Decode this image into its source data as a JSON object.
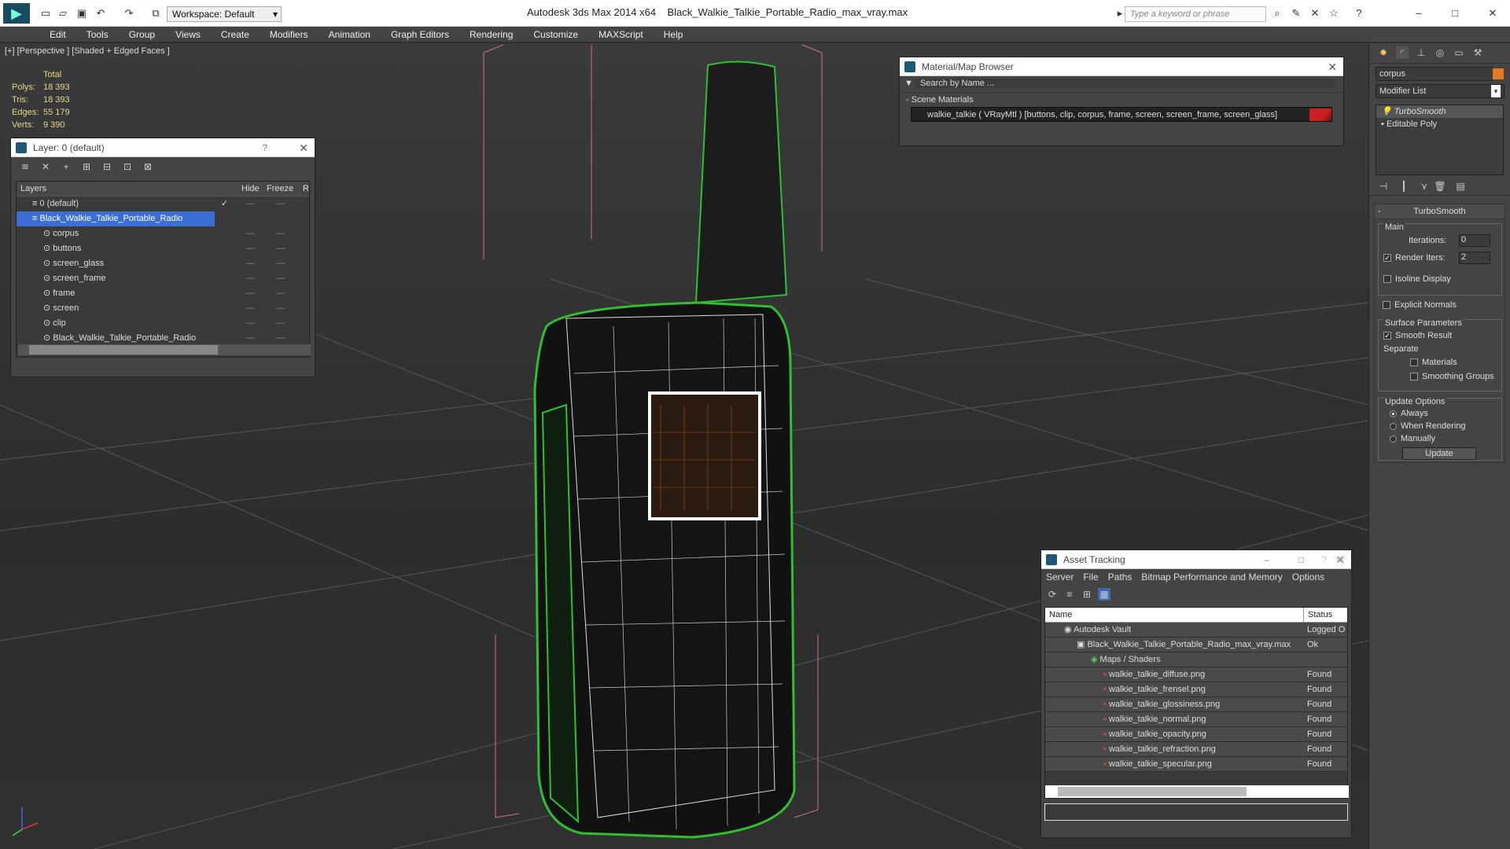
{
  "title": {
    "app": "Autodesk 3ds Max  2014 x64",
    "file": "Black_Walkie_Talkie_Portable_Radio_max_vray.max",
    "workspace": "Workspace: Default",
    "search_placeholder": "Type a keyword or phrase"
  },
  "menu": [
    "Edit",
    "Tools",
    "Group",
    "Views",
    "Create",
    "Modifiers",
    "Animation",
    "Graph Editors",
    "Rendering",
    "Customize",
    "MAXScript",
    "Help"
  ],
  "viewport": {
    "label": "[+] [Perspective ] [Shaded + Edged Faces ]",
    "stats": {
      "header": "Total",
      "rows": [
        {
          "k": "Polys:",
          "v": "18 393"
        },
        {
          "k": "Tris:",
          "v": "18 393"
        },
        {
          "k": "Edges:",
          "v": "55 179"
        },
        {
          "k": "Verts:",
          "v": "9 390"
        }
      ]
    }
  },
  "layer_panel": {
    "title": "Layer: 0 (default)",
    "cols": {
      "layers": "Layers",
      "hide": "Hide",
      "freeze": "Freeze",
      "r": "R"
    },
    "rows": [
      "0 (default)",
      "Black_Walkie_Talkie_Portable_Radio",
      "corpus",
      "buttons",
      "screen_glass",
      "screen_frame",
      "frame",
      "screen",
      "clip",
      "Black_Walkie_Talkie_Portable_Radio"
    ]
  },
  "material_browser": {
    "title": "Material/Map Browser",
    "search": "Search by Name ...",
    "section": "Scene Materials",
    "item": "walkie_talkie  ( VRayMtl ) [buttons, clip, corpus, frame, screen, screen_frame, screen_glass]"
  },
  "asset_tracking": {
    "title": "Asset Tracking",
    "menu": [
      "Server",
      "File",
      "Paths",
      "Bitmap Performance and Memory",
      "Options"
    ],
    "cols": {
      "name": "Name",
      "status": "Status"
    },
    "rows": [
      {
        "name": "Autodesk Vault",
        "status": "Logged O",
        "indent": 0
      },
      {
        "name": "Black_Walkie_Talkie_Portable_Radio_max_vray.max",
        "status": "Ok",
        "indent": 1
      },
      {
        "name": "Maps / Shaders",
        "status": "",
        "indent": 2
      },
      {
        "name": "walkie_talkie_diffuse.png",
        "status": "Found",
        "indent": 3
      },
      {
        "name": "walkie_talkie_frensel.png",
        "status": "Found",
        "indent": 3
      },
      {
        "name": "walkie_talkie_glossiness.png",
        "status": "Found",
        "indent": 3
      },
      {
        "name": "walkie_talkie_normal.png",
        "status": "Found",
        "indent": 3
      },
      {
        "name": "walkie_talkie_opacity.png",
        "status": "Found",
        "indent": 3
      },
      {
        "name": "walkie_talkie_refraction.png",
        "status": "Found",
        "indent": 3
      },
      {
        "name": "walkie_talkie_specular.png",
        "status": "Found",
        "indent": 3
      }
    ]
  },
  "command_panel": {
    "object_name": "corpus",
    "modifier_list": "Modifier List",
    "stack": [
      "TurboSmooth",
      "Editable Poly"
    ],
    "rollout": "TurboSmooth",
    "main": "Main",
    "iterations_label": "Iterations:",
    "iterations": "0",
    "render_iters_label": "Render Iters:",
    "render_iters": "2",
    "isoline": "Isoline Display",
    "explicit": "Explicit Normals",
    "surface": "Surface Parameters",
    "smooth_result": "Smooth Result",
    "separate": "Separate",
    "materials": "Materials",
    "smoothing_groups": "Smoothing Groups",
    "update_options": "Update Options",
    "always": "Always",
    "when_rendering": "When Rendering",
    "manually": "Manually",
    "update": "Update"
  }
}
